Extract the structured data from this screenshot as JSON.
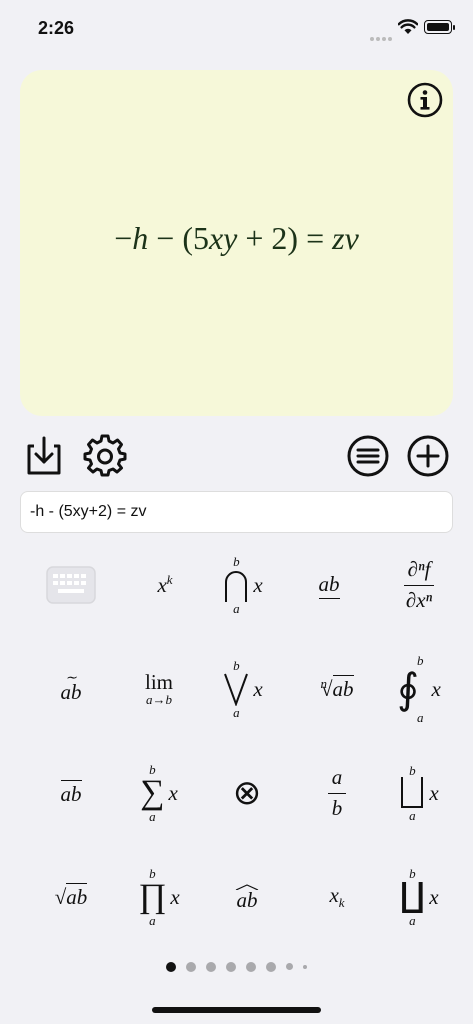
{
  "status": {
    "time": "2:26"
  },
  "preview": {
    "expression": [
      "−",
      "h",
      " − (5",
      "xy",
      " + 2) = ",
      "zv"
    ]
  },
  "input": {
    "value": "-h - (5xy+2) = zv"
  },
  "toolbar": {
    "left": [
      "download-icon",
      "gear-icon"
    ],
    "right": [
      "list-icon",
      "add-icon"
    ]
  },
  "keys": {
    "row1": {
      "power_base": "x",
      "power_exp": "k",
      "cap_b": "b",
      "cap_a": "a",
      "cap_x": "x",
      "underline": "ab",
      "partial_num": "∂ⁿf",
      "partial_den": "∂xⁿ"
    },
    "row2": {
      "tilde": "ab",
      "lim": "lim",
      "lim_sub": "a→b",
      "vee_b": "b",
      "vee_a": "a",
      "vee_x": "x",
      "root_n": "n",
      "root_body": "ab",
      "oint_b": "b",
      "oint_a": "a",
      "oint_x": "x"
    },
    "row3": {
      "overline": "ab",
      "sum_b": "b",
      "sum_a": "a",
      "sum_x": "x",
      "otimes": "⊗",
      "frac_num": "a",
      "frac_den": "b",
      "cup_b": "b",
      "cup_a": "a",
      "cup_x": "x"
    },
    "row4": {
      "sqrt_body": "ab",
      "prod_b": "b",
      "prod_a": "a",
      "prod_x": "x",
      "hat": "ab",
      "sub_base": "x",
      "sub_k": "k",
      "coprod_b": "b",
      "coprod_a": "a",
      "coprod_x": "x"
    }
  },
  "pager": {
    "pages": 8,
    "current": 1
  }
}
